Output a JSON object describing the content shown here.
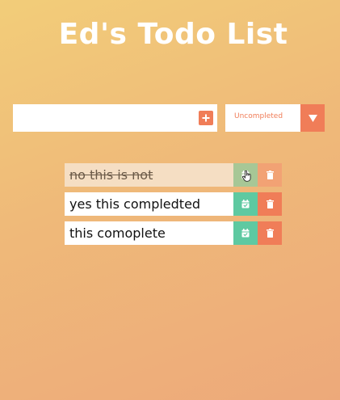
{
  "app": {
    "title": "Ed's Todo List"
  },
  "input": {
    "value": "",
    "placeholder": "",
    "add_icon": "plus-icon"
  },
  "filter": {
    "selected": "Uncompleted",
    "arrow_icon": "caret-down-icon"
  },
  "todos": [
    {
      "text": "no this is not",
      "completed": true
    },
    {
      "text": "yes this compledted",
      "completed": false
    },
    {
      "text": "this comoplete",
      "completed": false
    }
  ],
  "icons": {
    "check": "calendar-check-icon",
    "delete": "trash-icon",
    "cursor": "hand-pointer-icon"
  },
  "colors": {
    "accent": "#f07d58",
    "complete": "#5ec9a1",
    "background_start": "#f2cd79",
    "background_end": "#eda97a"
  }
}
